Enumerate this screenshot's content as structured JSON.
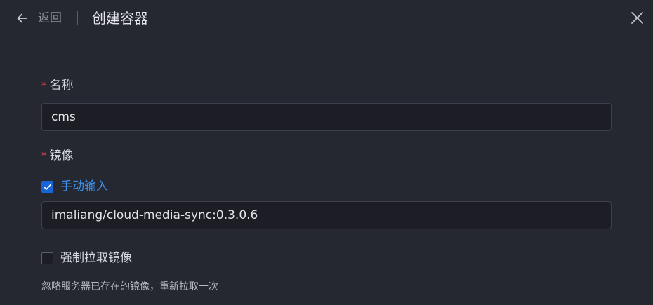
{
  "header": {
    "back_label": "返回",
    "title": "创建容器"
  },
  "form": {
    "name": {
      "required_mark": "*",
      "label": "名称",
      "value": "cms"
    },
    "image": {
      "required_mark": "*",
      "label": "镜像",
      "manual_input": {
        "checked": true,
        "label": "手动输入"
      },
      "value": "imaliang/cloud-media-sync:0.3.0.6"
    },
    "force_pull": {
      "checked": false,
      "label": "强制拉取镜像",
      "hint": "忽略服务器已存在的镜像，重新拉取一次"
    }
  },
  "colors": {
    "background": "#252731",
    "input_bg": "#1d1e25",
    "accent": "#3d8fe8",
    "checkbox_checked": "#1765d8",
    "required": "#e5484d"
  },
  "icons": {
    "back": "arrow-left-icon",
    "close": "close-icon",
    "check": "check-icon"
  }
}
